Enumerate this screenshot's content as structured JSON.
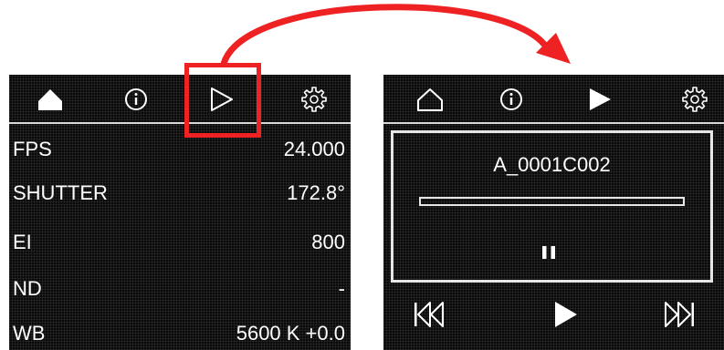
{
  "left_panel": {
    "tabs": [
      {
        "icon": "home-filled-icon"
      },
      {
        "icon": "info-icon"
      },
      {
        "icon": "play-outline-icon"
      },
      {
        "icon": "gear-icon"
      }
    ],
    "rows": [
      {
        "label": "FPS",
        "value": "24.000"
      },
      {
        "label": "SHUTTER",
        "value": "172.8°"
      },
      {
        "label": "EI",
        "value": "800"
      },
      {
        "label": "ND",
        "value": "-"
      },
      {
        "label": "WB",
        "value": "5600 K +0.0"
      }
    ]
  },
  "right_panel": {
    "tabs": [
      {
        "icon": "home-outline-icon"
      },
      {
        "icon": "info-icon"
      },
      {
        "icon": "play-filled-icon"
      },
      {
        "icon": "gear-icon"
      }
    ],
    "player": {
      "clip_name": "A_0001C002",
      "progress": 0,
      "state_icon": "pause-icon"
    },
    "transport": [
      "skip-back-icon",
      "play-icon",
      "skip-forward-icon"
    ]
  },
  "annotation": {
    "highlight_color": "#ee2222",
    "arrow_color": "#ee2222",
    "target": "play-tab"
  },
  "colors": {
    "screen_bg": "#0a0a0a",
    "text": "#ffffff",
    "highlight": "#ee2222"
  }
}
